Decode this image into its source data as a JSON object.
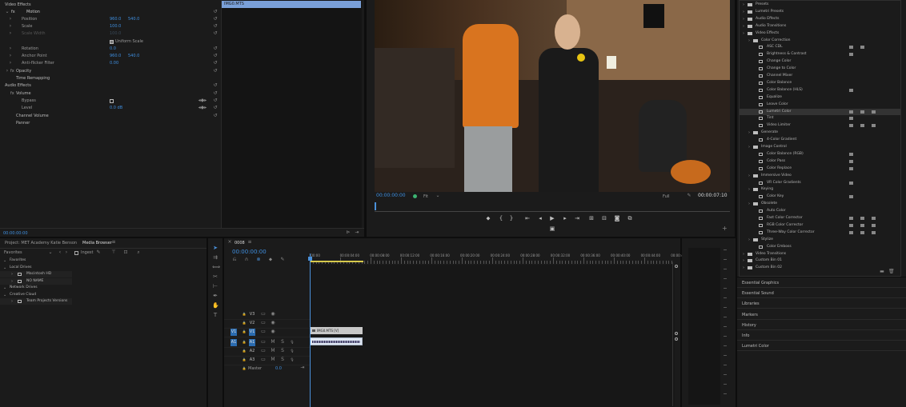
{
  "effect_controls": {
    "header": "Video Effects",
    "motion": "Motion",
    "props": [
      {
        "label": "Position",
        "v1": "960.0",
        "v2": "540.0"
      },
      {
        "label": "Scale",
        "v1": "100.0",
        "v2": ""
      },
      {
        "label": "Scale Width",
        "v1": "100.0",
        "v2": ""
      },
      {
        "label": "Uniform Scale",
        "v1": "",
        "v2": ""
      },
      {
        "label": "Rotation",
        "v1": "0.0",
        "v2": ""
      },
      {
        "label": "Anchor Point",
        "v1": "960.0",
        "v2": "540.0"
      },
      {
        "label": "Anti-flicker Filter",
        "v1": "0.00",
        "v2": ""
      }
    ],
    "opacity": "Opacity",
    "time_remapping": "Time Remapping",
    "audio_effects": "Audio Effects",
    "volume": "Volume",
    "bypass": "Bypass",
    "level": "Level",
    "level_value": "0.0 dB",
    "channel_volume": "Channel Volume",
    "panner": "Panner",
    "timecode": "00:00:00:00",
    "clip_name": "IMG0.MTS"
  },
  "program": {
    "timecode": "00:00:00:00",
    "fit": "Fit",
    "quality": "Full",
    "duration": "00:00:07:10"
  },
  "project": {
    "project_tab": "Project: MET Academy Katie Benson",
    "media_browser_tab": "Media Browser",
    "favorites_dropdown": "Favorites",
    "ingest": "Ingest",
    "tree": [
      {
        "label": "Favorites",
        "level": 0
      },
      {
        "label": "Local Drives",
        "level": 0
      },
      {
        "label": "Macintosh HD",
        "level": 1
      },
      {
        "label": "NO NAME",
        "level": 1
      },
      {
        "label": "Network Drives",
        "level": 0
      },
      {
        "label": "Creative Cloud",
        "level": 0
      },
      {
        "label": "Team Projects Versions",
        "level": 1
      }
    ]
  },
  "timeline": {
    "sequence_tab": "0008",
    "timecode": "00:00:00:00",
    "ruler": [
      ":00:00",
      "00:00:04:00",
      "00:00:08:00",
      "00:00:12:00",
      "00:00:16:00",
      "00:00:20:00",
      "00:00:24:00",
      "00:00:28:00",
      "00:00:32:00",
      "00:00:36:00",
      "00:00:40:00",
      "00:00:44:00",
      "00:00:4"
    ],
    "tracks": [
      {
        "name": "V3",
        "type": "video"
      },
      {
        "name": "V2",
        "type": "video"
      },
      {
        "name": "V1",
        "type": "video",
        "target": "V1"
      },
      {
        "name": "A1",
        "type": "audio",
        "target": "A1"
      },
      {
        "name": "A2",
        "type": "audio"
      },
      {
        "name": "A3",
        "type": "audio"
      }
    ],
    "master": "Master",
    "master_value": "0.0",
    "clip_label": "IMG0.MTS [V]"
  },
  "effects": {
    "tree": [
      {
        "label": "Presets",
        "level": 0,
        "kind": "folder"
      },
      {
        "label": "Lumetri Presets",
        "level": 0,
        "kind": "folder"
      },
      {
        "label": "Audio Effects",
        "level": 0,
        "kind": "folder"
      },
      {
        "label": "Audio Transitions",
        "level": 0,
        "kind": "folder"
      },
      {
        "label": "Video Effects",
        "level": 0,
        "kind": "folder"
      },
      {
        "label": "Color Correction",
        "level": 1,
        "kind": "folder"
      },
      {
        "label": "ASC CDL",
        "level": 2,
        "kind": "fx",
        "badges": 2
      },
      {
        "label": "Brightness & Contrast",
        "level": 2,
        "kind": "fx",
        "badges": 1
      },
      {
        "label": "Change Color",
        "level": 2,
        "kind": "fx",
        "badges": 0
      },
      {
        "label": "Change to Color",
        "level": 2,
        "kind": "fx",
        "badges": 0
      },
      {
        "label": "Channel Mixer",
        "level": 2,
        "kind": "fx",
        "badges": 0
      },
      {
        "label": "Color Balance",
        "level": 2,
        "kind": "fx",
        "badges": 0
      },
      {
        "label": "Color Balance (HLS)",
        "level": 2,
        "kind": "fx",
        "badges": 1
      },
      {
        "label": "Equalize",
        "level": 2,
        "kind": "fx",
        "badges": 0
      },
      {
        "label": "Leave Color",
        "level": 2,
        "kind": "fx",
        "badges": 0
      },
      {
        "label": "Lumetri Color",
        "level": 2,
        "kind": "fx",
        "badges": 3,
        "selected": true
      },
      {
        "label": "Tint",
        "level": 2,
        "kind": "fx",
        "badges": 1
      },
      {
        "label": "Video Limiter",
        "level": 2,
        "kind": "fx",
        "badges": 3
      },
      {
        "label": "Generate",
        "level": 1,
        "kind": "folder"
      },
      {
        "label": "4-Color Gradient",
        "level": 2,
        "kind": "fx",
        "badges": 0
      },
      {
        "label": "Image Control",
        "level": 1,
        "kind": "folder"
      },
      {
        "label": "Color Balance (RGB)",
        "level": 2,
        "kind": "fx",
        "badges": 1
      },
      {
        "label": "Color Pass",
        "level": 2,
        "kind": "fx",
        "badges": 1
      },
      {
        "label": "Color Replace",
        "level": 2,
        "kind": "fx",
        "badges": 1
      },
      {
        "label": "Immersive Video",
        "level": 1,
        "kind": "folder"
      },
      {
        "label": "VR Color Gradients",
        "level": 2,
        "kind": "fx",
        "badges": 1
      },
      {
        "label": "Keying",
        "level": 1,
        "kind": "folder"
      },
      {
        "label": "Color Key",
        "level": 2,
        "kind": "fx",
        "badges": 1
      },
      {
        "label": "Obsolete",
        "level": 1,
        "kind": "folder"
      },
      {
        "label": "Auto Color",
        "level": 2,
        "kind": "fx",
        "badges": 0
      },
      {
        "label": "Fast Color Corrector",
        "level": 2,
        "kind": "fx",
        "badges": 3
      },
      {
        "label": "RGB Color Corrector",
        "level": 2,
        "kind": "fx",
        "badges": 3
      },
      {
        "label": "Three-Way Color Corrector",
        "level": 2,
        "kind": "fx",
        "badges": 3
      },
      {
        "label": "Stylize",
        "level": 1,
        "kind": "folder"
      },
      {
        "label": "Color Emboss",
        "level": 2,
        "kind": "fx",
        "badges": 0
      },
      {
        "label": "Video Transitions",
        "level": 0,
        "kind": "folder"
      },
      {
        "label": "Custom Bin 01",
        "level": 0,
        "kind": "folder"
      },
      {
        "label": "Custom Bin 02",
        "level": 0,
        "kind": "folder"
      }
    ],
    "panels": [
      "Essential Graphics",
      "Essential Sound",
      "Libraries",
      "Markers",
      "History",
      "Info",
      "Lumetri Color"
    ]
  },
  "colors": {
    "accent": "#3f8fe0",
    "selection": "#2b6cb0",
    "playhead": "#4a90d9",
    "clip_video": "#c8c8c8",
    "clip_audio": "#dfe7f2"
  }
}
